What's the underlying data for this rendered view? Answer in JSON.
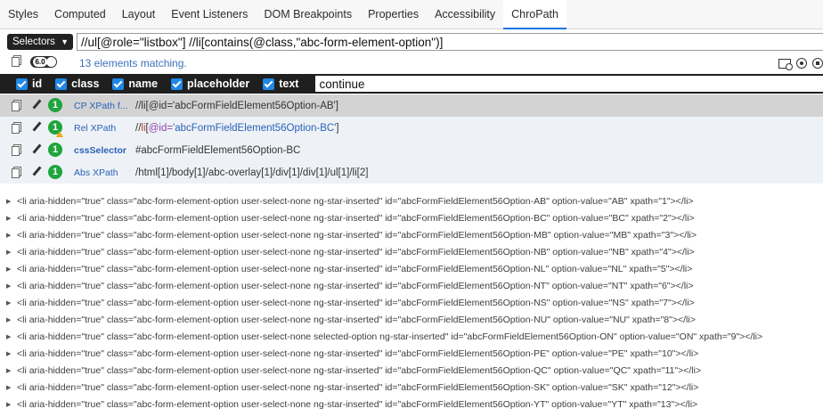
{
  "tabs": [
    {
      "label": "Styles",
      "active": false
    },
    {
      "label": "Computed",
      "active": false
    },
    {
      "label": "Layout",
      "active": false
    },
    {
      "label": "Event Listeners",
      "active": false
    },
    {
      "label": "DOM Breakpoints",
      "active": false
    },
    {
      "label": "Properties",
      "active": false
    },
    {
      "label": "Accessibility",
      "active": false
    },
    {
      "label": "ChroPath",
      "active": true
    }
  ],
  "selector_dropdown": {
    "label": "Selectors"
  },
  "xpath_input": {
    "value": "//ul[@role=\"listbox\"] //li[contains(@class,\"abc-form-element-option\")]"
  },
  "version_toggle": {
    "label": "6.0"
  },
  "match_status": "13 elements matching.",
  "attributes": [
    {
      "label": "id",
      "checked": true
    },
    {
      "label": "class",
      "checked": true
    },
    {
      "label": "name",
      "checked": true
    },
    {
      "label": "placeholder",
      "checked": true
    },
    {
      "label": "text",
      "checked": true
    }
  ],
  "text_filter": {
    "value": "continue"
  },
  "selectors": [
    {
      "type": "CP XPath f...",
      "count": "1",
      "value": "//li[@id='abcFormFieldElement56Option-AB']"
    },
    {
      "type": "Rel XPath",
      "count": "1",
      "value_parts": [
        "//",
        "li",
        "[",
        "@id=",
        "'abcFormFieldElement56Option-BC'",
        "]"
      ]
    },
    {
      "type": "cssSelector",
      "count": "1",
      "value": "#abcFormFieldElement56Option-BC"
    },
    {
      "type": "Abs XPath",
      "count": "1",
      "value": "/html[1]/body[1]/abc-overlay[1]/div[1]/div[1]/ul[1]/li[2]"
    }
  ],
  "elements": [
    "<li aria-hidden=\"true\" class=\"abc-form-element-option user-select-none ng-star-inserted\" id=\"abcFormFieldElement56Option-AB\" option-value=\"AB\" xpath=\"1\"></li>",
    "<li aria-hidden=\"true\" class=\"abc-form-element-option user-select-none ng-star-inserted\" id=\"abcFormFieldElement56Option-BC\" option-value=\"BC\" xpath=\"2\"></li>",
    "<li aria-hidden=\"true\" class=\"abc-form-element-option user-select-none ng-star-inserted\" id=\"abcFormFieldElement56Option-MB\" option-value=\"MB\" xpath=\"3\"></li>",
    "<li aria-hidden=\"true\" class=\"abc-form-element-option user-select-none ng-star-inserted\" id=\"abcFormFieldElement56Option-NB\" option-value=\"NB\" xpath=\"4\"></li>",
    "<li aria-hidden=\"true\" class=\"abc-form-element-option user-select-none ng-star-inserted\" id=\"abcFormFieldElement56Option-NL\" option-value=\"NL\" xpath=\"5\"></li>",
    "<li aria-hidden=\"true\" class=\"abc-form-element-option user-select-none ng-star-inserted\" id=\"abcFormFieldElement56Option-NT\" option-value=\"NT\" xpath=\"6\"></li>",
    "<li aria-hidden=\"true\" class=\"abc-form-element-option user-select-none ng-star-inserted\" id=\"abcFormFieldElement56Option-NS\" option-value=\"NS\" xpath=\"7\"></li>",
    "<li aria-hidden=\"true\" class=\"abc-form-element-option user-select-none ng-star-inserted\" id=\"abcFormFieldElement56Option-NU\" option-value=\"NU\" xpath=\"8\"></li>",
    "<li aria-hidden=\"true\" class=\"abc-form-element-option user-select-none selected-option ng-star-inserted\" id=\"abcFormFieldElement56Option-ON\" option-value=\"ON\" xpath=\"9\"></li>",
    "<li aria-hidden=\"true\" class=\"abc-form-element-option user-select-none ng-star-inserted\" id=\"abcFormFieldElement56Option-PE\" option-value=\"PE\" xpath=\"10\"></li>",
    "<li aria-hidden=\"true\" class=\"abc-form-element-option user-select-none ng-star-inserted\" id=\"abcFormFieldElement56Option-QC\" option-value=\"QC\" xpath=\"11\"></li>",
    "<li aria-hidden=\"true\" class=\"abc-form-element-option user-select-none ng-star-inserted\" id=\"abcFormFieldElement56Option-SK\" option-value=\"SK\" xpath=\"12\"></li>",
    "<li aria-hidden=\"true\" class=\"abc-form-element-option user-select-none ng-star-inserted\" id=\"abcFormFieldElement56Option-YT\" option-value=\"YT\" xpath=\"13\"></li>"
  ]
}
